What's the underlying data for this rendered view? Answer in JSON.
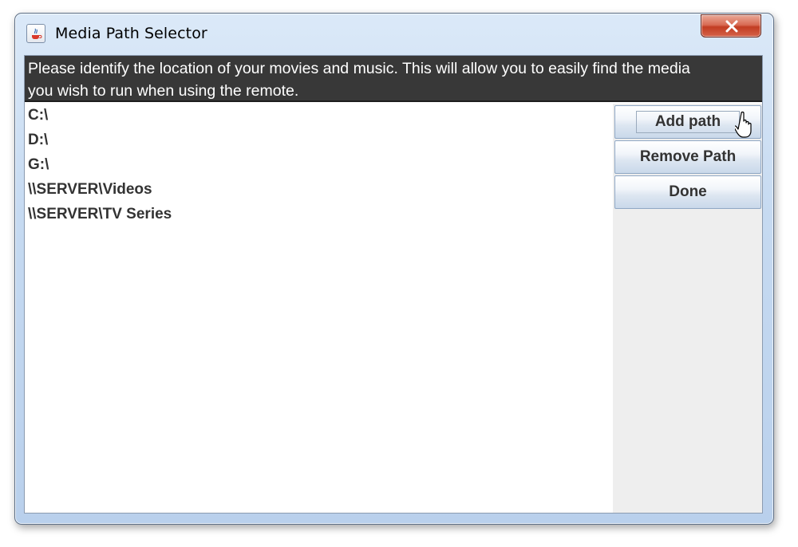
{
  "window": {
    "title": "Media Path Selector",
    "icon": "java-cup-icon",
    "close_icon": "close-x-icon"
  },
  "banner": {
    "line1": "Please identify the location of your movies and music. This will allow you to easily find the media",
    "line2": "you wish to run when using the remote."
  },
  "paths": [
    "C:\\",
    "D:\\",
    "G:\\",
    "\\\\SERVER\\Videos",
    "\\\\SERVER\\TV Series"
  ],
  "buttons": {
    "add_path": "Add path",
    "remove_path": "Remove Path",
    "done": "Done"
  },
  "colors": {
    "banner_bg": "#383838",
    "banner_text": "#ffffff",
    "close_button": "#c23d22"
  }
}
